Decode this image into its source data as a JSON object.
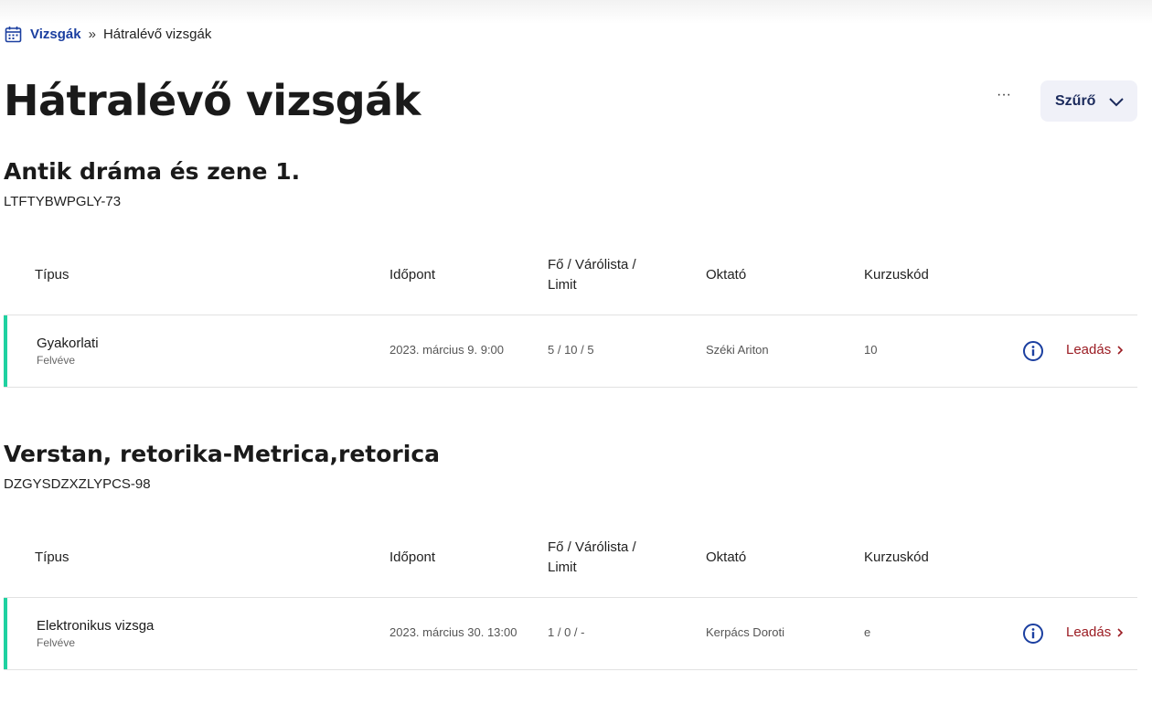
{
  "breadcrumb": {
    "root": "Vizsgák",
    "separator": "»",
    "current": "Hátralévő vizsgák"
  },
  "page": {
    "title": "Hátralévő vizsgák",
    "more_label": "···",
    "filter_label": "Szűrő"
  },
  "columns": {
    "type": "Típus",
    "time": "Időpont",
    "seats_line1": "Fő / Várólista /",
    "seats_line2": "Limit",
    "teacher": "Oktató",
    "course_code": "Kurzuskód"
  },
  "courses": [
    {
      "title": "Antik dráma és zene 1.",
      "code": "LTFTYBWPGLY-73",
      "exam": {
        "type": "Gyakorlati",
        "status": "Felvéve",
        "time": "2023. március 9. 9:00",
        "seats": "5 / 10 / 5",
        "teacher": "Széki Ariton",
        "course_code": "10",
        "action": "Leadás"
      }
    },
    {
      "title": "Verstan, retorika-Metrica,retorica",
      "code": "DZGYSDZXZLYPCS-98",
      "exam": {
        "type": "Elektronikus vizsga",
        "status": "Felvéve",
        "time": "2023. március 30. 13:00",
        "seats": "1 / 0 / -",
        "teacher": "Kerpács Doroti",
        "course_code": "e",
        "action": "Leadás"
      }
    }
  ],
  "colors": {
    "accent": "#1fd1a0",
    "link": "#1b3fa0",
    "action": "#9b1c23"
  }
}
